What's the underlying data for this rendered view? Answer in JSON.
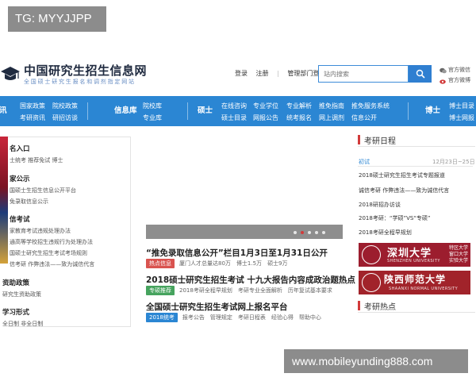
{
  "overlay": {
    "tag": "TG: MYYJJPP",
    "watermark": "www.mobileyunding888.com"
  },
  "header": {
    "site_title": "中国研究生招生信息网",
    "site_subtitle": "全国硕士研究生报名和调剂指定网站",
    "links": [
      "登录",
      "注册",
      "管理部门登录"
    ],
    "search_placeholder": "站内搜索",
    "social": [
      "官方微信",
      "官方微博"
    ]
  },
  "nav": {
    "cat1_items": [
      "国家政策",
      "院校政策",
      "考研资讯",
      "研招访谈"
    ],
    "cat1_cut": "讯",
    "cat2_label": "信息库",
    "cat2_items": [
      "院校库",
      "专业库"
    ],
    "cat3_label": "硕士",
    "cat3_items": [
      "在线咨询",
      "专业学位",
      "专业解析",
      "推免指南",
      "推免服务系统",
      "硕士目录",
      "网报公告",
      "统考报名",
      "网上调剂",
      "信息公开"
    ],
    "cat4_label": "博士",
    "cat4_items": [
      "博士目录",
      "博士网报"
    ]
  },
  "left_panel": {
    "s1_head": "名入口",
    "s1_lines": [
      "士统考  推荐免试  博士"
    ],
    "s2_head": "家公示",
    "s2_lines": [
      "国硕士生招生信息公开平台",
      "免录取信息公示"
    ],
    "s3_head": "信考试",
    "s3_lines": [
      "家教育考试违规处理办法",
      "通高等学校招生违规行为处理办法",
      "国硕士研究生招生考试考场规则",
      "信考研  作弊违法——致为诚信代言"
    ],
    "s4_head": "资助政策",
    "s4_lines": [
      "研究生资助政策"
    ],
    "s5_head": "学习形式",
    "s5_lines": [
      "全日制    非全日制"
    ]
  },
  "slider": {
    "dot_count": 5,
    "active_index": 1
  },
  "news": [
    {
      "title": "“推免录取信息公开”栏目1月3日至1月31日公开",
      "badge": "热点信息",
      "badge_color": "#d9534f",
      "links": [
        "厦门人才总量达80万",
        "博士1.5万",
        "硕士9万"
      ]
    },
    {
      "title": "2018硕士研究生招生考试 十九大报告内容成政治题热点",
      "badge": "专硕推荐",
      "badge_color": "#46a35e",
      "links": [
        "2018考研全程早规划",
        "考研专业全面解析",
        "历年复试基本要求"
      ]
    },
    {
      "title": "全国硕士研究生招生考试网上报名平台",
      "badge": "2018统考",
      "badge_color": "#2b86d3",
      "links": [
        "报考公告",
        "管理规定",
        "考研日程表",
        "经验心得",
        "帮助中心"
      ]
    }
  ],
  "calendar": {
    "heading": "考研日程",
    "tab": "初试",
    "date": "12月23日~25日",
    "items": [
      "2018硕士研究生招生考试专题报道",
      "诚信考研 作弊违法——致为诚信代言",
      "2018研招办访谈",
      "2018考研：“学硕”VS“专硕”",
      "2018考研全程早规划"
    ]
  },
  "banners": [
    {
      "name": "深圳大学",
      "sub": "SHENZHEN UNIVERSITY",
      "side": "特区大学 窗口大学 实验大学",
      "color": "#9c1d2e"
    },
    {
      "name": "陕西师范大学",
      "sub": "SHAANXI NORMAL UNIVERSITY",
      "side": "",
      "color": "#a1232a"
    }
  ],
  "hot_heading": "考研热点",
  "colors": {
    "nav_blue": "#2b86d3",
    "accent_red": "#d23b3b"
  }
}
